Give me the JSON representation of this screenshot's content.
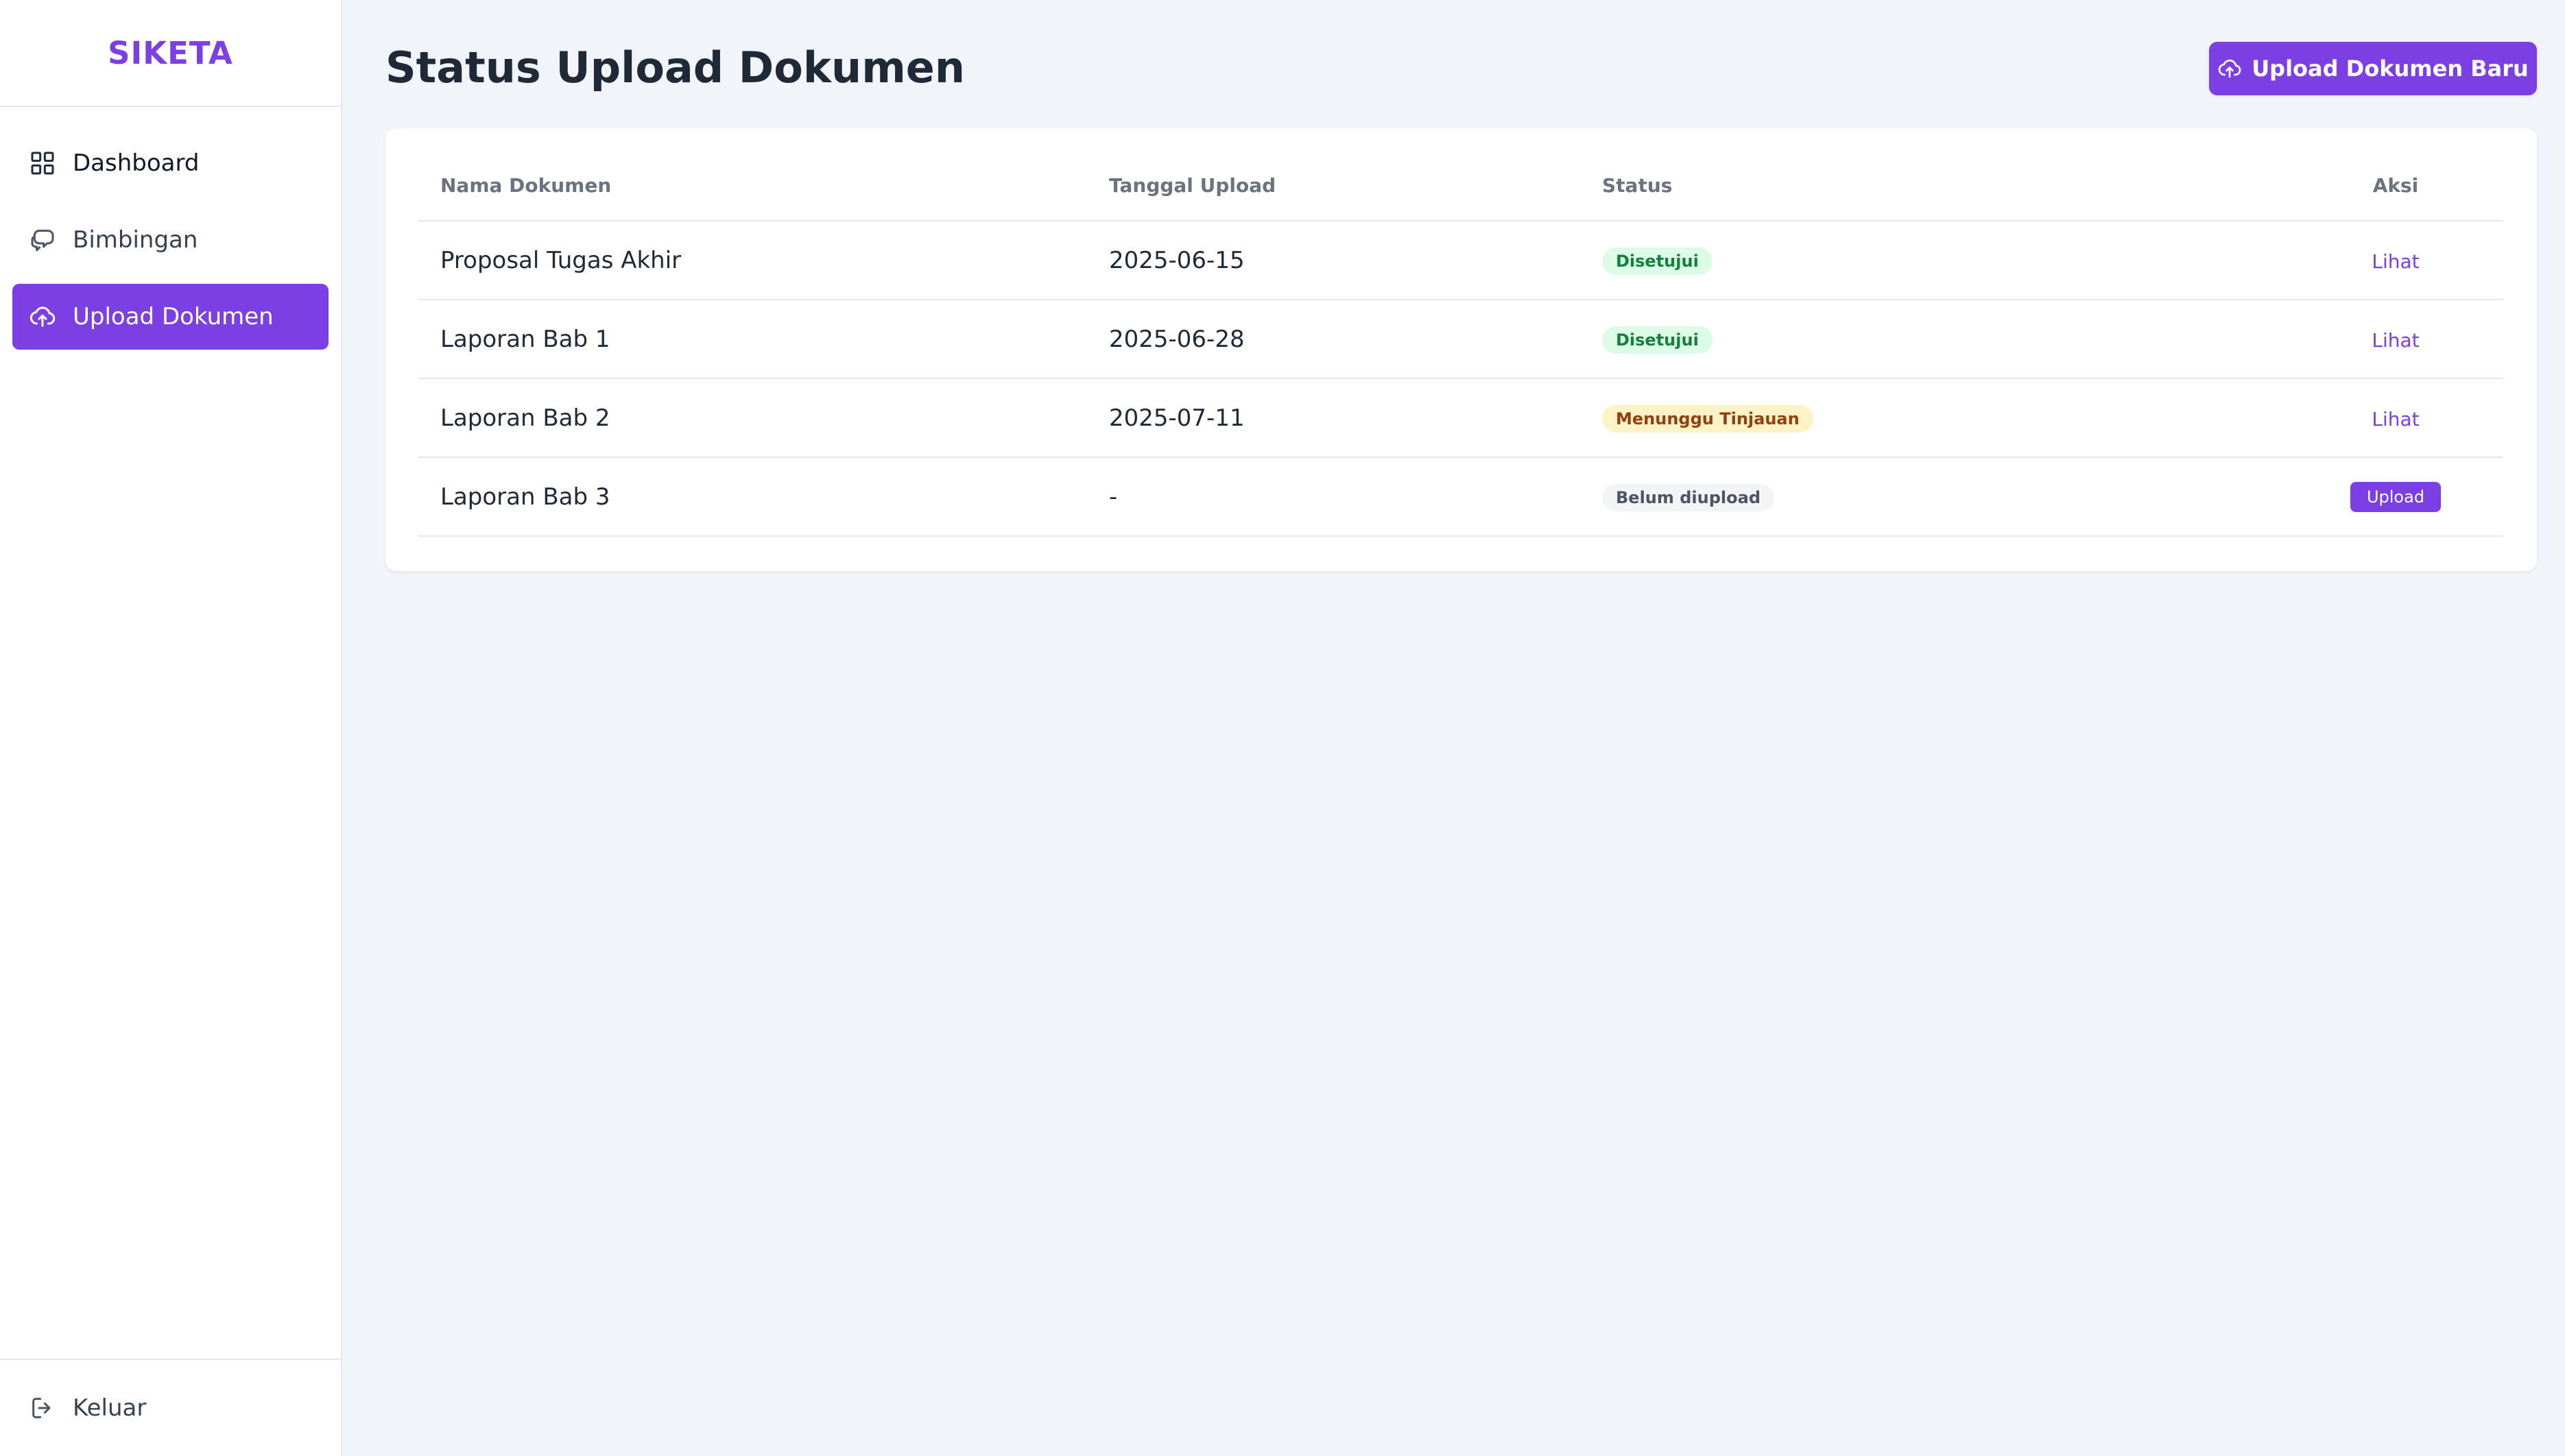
{
  "app": {
    "name": "SIKETA",
    "accent": "#7b3fe4"
  },
  "sidebar": {
    "items": [
      {
        "label": "Dashboard",
        "icon": "grid-icon"
      },
      {
        "label": "Bimbingan",
        "icon": "chat-bubbles-icon"
      },
      {
        "label": "Upload Dokumen",
        "icon": "cloud-upload-icon",
        "active": true
      }
    ],
    "logout_label": "Keluar"
  },
  "header": {
    "title": "Status Upload Dokumen",
    "upload_button_label": "Upload Dokumen Baru"
  },
  "table": {
    "columns": [
      "Nama Dokumen",
      "Tanggal Upload",
      "Status",
      "Aksi"
    ],
    "rows": [
      {
        "name": "Proposal Tugas Akhir",
        "date": "2025-06-15",
        "status": "Disetujui",
        "action": "Lihat"
      },
      {
        "name": "Laporan Bab 1",
        "date": "2025-06-28",
        "status": "Disetujui",
        "action": "Lihat"
      },
      {
        "name": "Laporan Bab 2",
        "date": "2025-07-11",
        "status": "Menunggu Tinjauan",
        "action": "Lihat"
      },
      {
        "name": "Laporan Bab 3",
        "date": "-",
        "status": "Belum diupload",
        "action": "Upload"
      }
    ]
  }
}
